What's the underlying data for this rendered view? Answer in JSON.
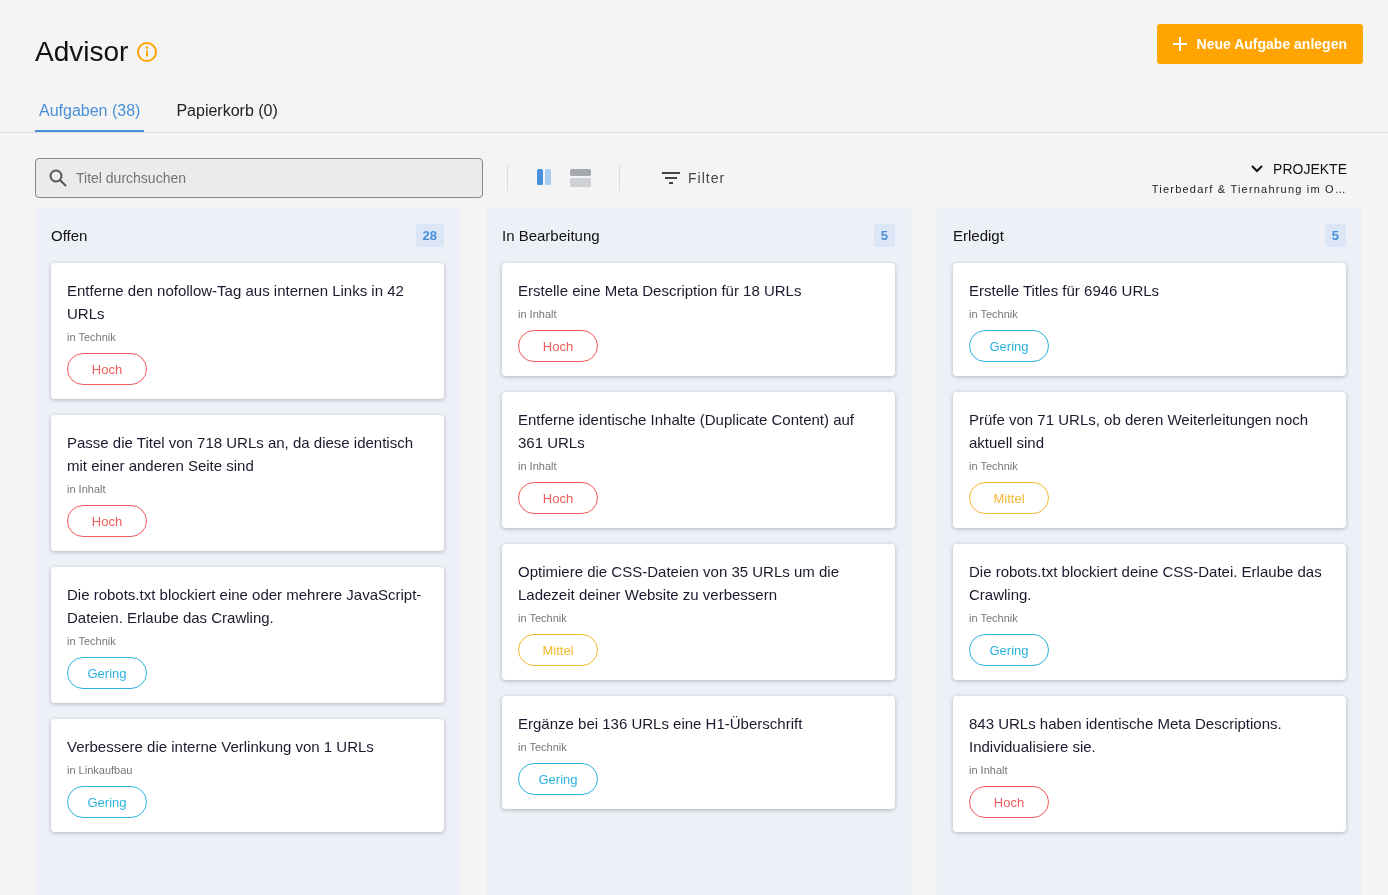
{
  "header": {
    "title": "Advisor",
    "button": "Neue Aufgabe anlegen"
  },
  "tabs": [
    {
      "label": "Aufgaben (38)",
      "selected": true
    },
    {
      "label": "Papierkorb (0)",
      "selected": false
    }
  ],
  "search": {
    "placeholder": "Titel durchsuchen"
  },
  "view_toggle": [
    {
      "kind": "columns",
      "selected": true
    },
    {
      "kind": "rows",
      "selected": false
    }
  ],
  "filter": "Filter",
  "projects": {
    "label": "PROJEKTE",
    "value": "Tierbedarf & Tiernahrung im O…"
  },
  "columns": [
    {
      "title": "Offen",
      "count": "28",
      "cards": [
        {
          "title": "Entferne den nofollow-Tag aus internen Links in 42 URLs",
          "category": "in Technik",
          "priority": "Hoch",
          "kind": "high"
        },
        {
          "title": "Passe die Titel von 718 URLs an, da diese identisch mit einer anderen Seite sind",
          "category": "in Inhalt",
          "priority": "Hoch",
          "kind": "high"
        },
        {
          "title": "Die robots.txt blockiert eine oder mehrere JavaScript-Dateien. Erlaube das Crawling.",
          "category": "in Technik",
          "priority": "Gering",
          "kind": "low"
        },
        {
          "title": "Verbessere die interne Verlinkung von 1 URLs",
          "category": "in Linkaufbau",
          "priority": "Gering",
          "kind": "low"
        }
      ]
    },
    {
      "title": "In Bearbeitung",
      "count": "5",
      "cards": [
        {
          "title": "Erstelle eine Meta Description für 18 URLs",
          "category": "in Inhalt",
          "priority": "Hoch",
          "kind": "high"
        },
        {
          "title": "Entferne identische Inhalte (Duplicate Content) auf 361 URLs",
          "category": "in Inhalt",
          "priority": "Hoch",
          "kind": "high"
        },
        {
          "title": "Optimiere die CSS-Dateien von 35 URLs um die Ladezeit deiner Website zu verbessern",
          "category": "in Technik",
          "priority": "Mittel",
          "kind": "medium"
        },
        {
          "title": "Ergänze bei 136 URLs eine H1-Überschrift",
          "category": "in Technik",
          "priority": "Gering",
          "kind": "low"
        }
      ]
    },
    {
      "title": "Erledigt",
      "count": "5",
      "cards": [
        {
          "title": "Erstelle Titles für 6946 URLs",
          "category": "in Technik",
          "priority": "Gering",
          "kind": "low"
        },
        {
          "title": "Prüfe von 71 URLs, ob deren Weiterleitungen noch aktuell sind",
          "category": "in Technik",
          "priority": "Mittel",
          "kind": "medium"
        },
        {
          "title": "Die robots.txt blockiert deine CSS-Datei. Erlaube das Crawling.",
          "category": "in Technik",
          "priority": "Gering",
          "kind": "low"
        },
        {
          "title": "843 URLs haben identische Meta Descriptions. Individualisiere sie.",
          "category": "in Inhalt",
          "priority": "Hoch",
          "kind": "high"
        }
      ]
    }
  ]
}
